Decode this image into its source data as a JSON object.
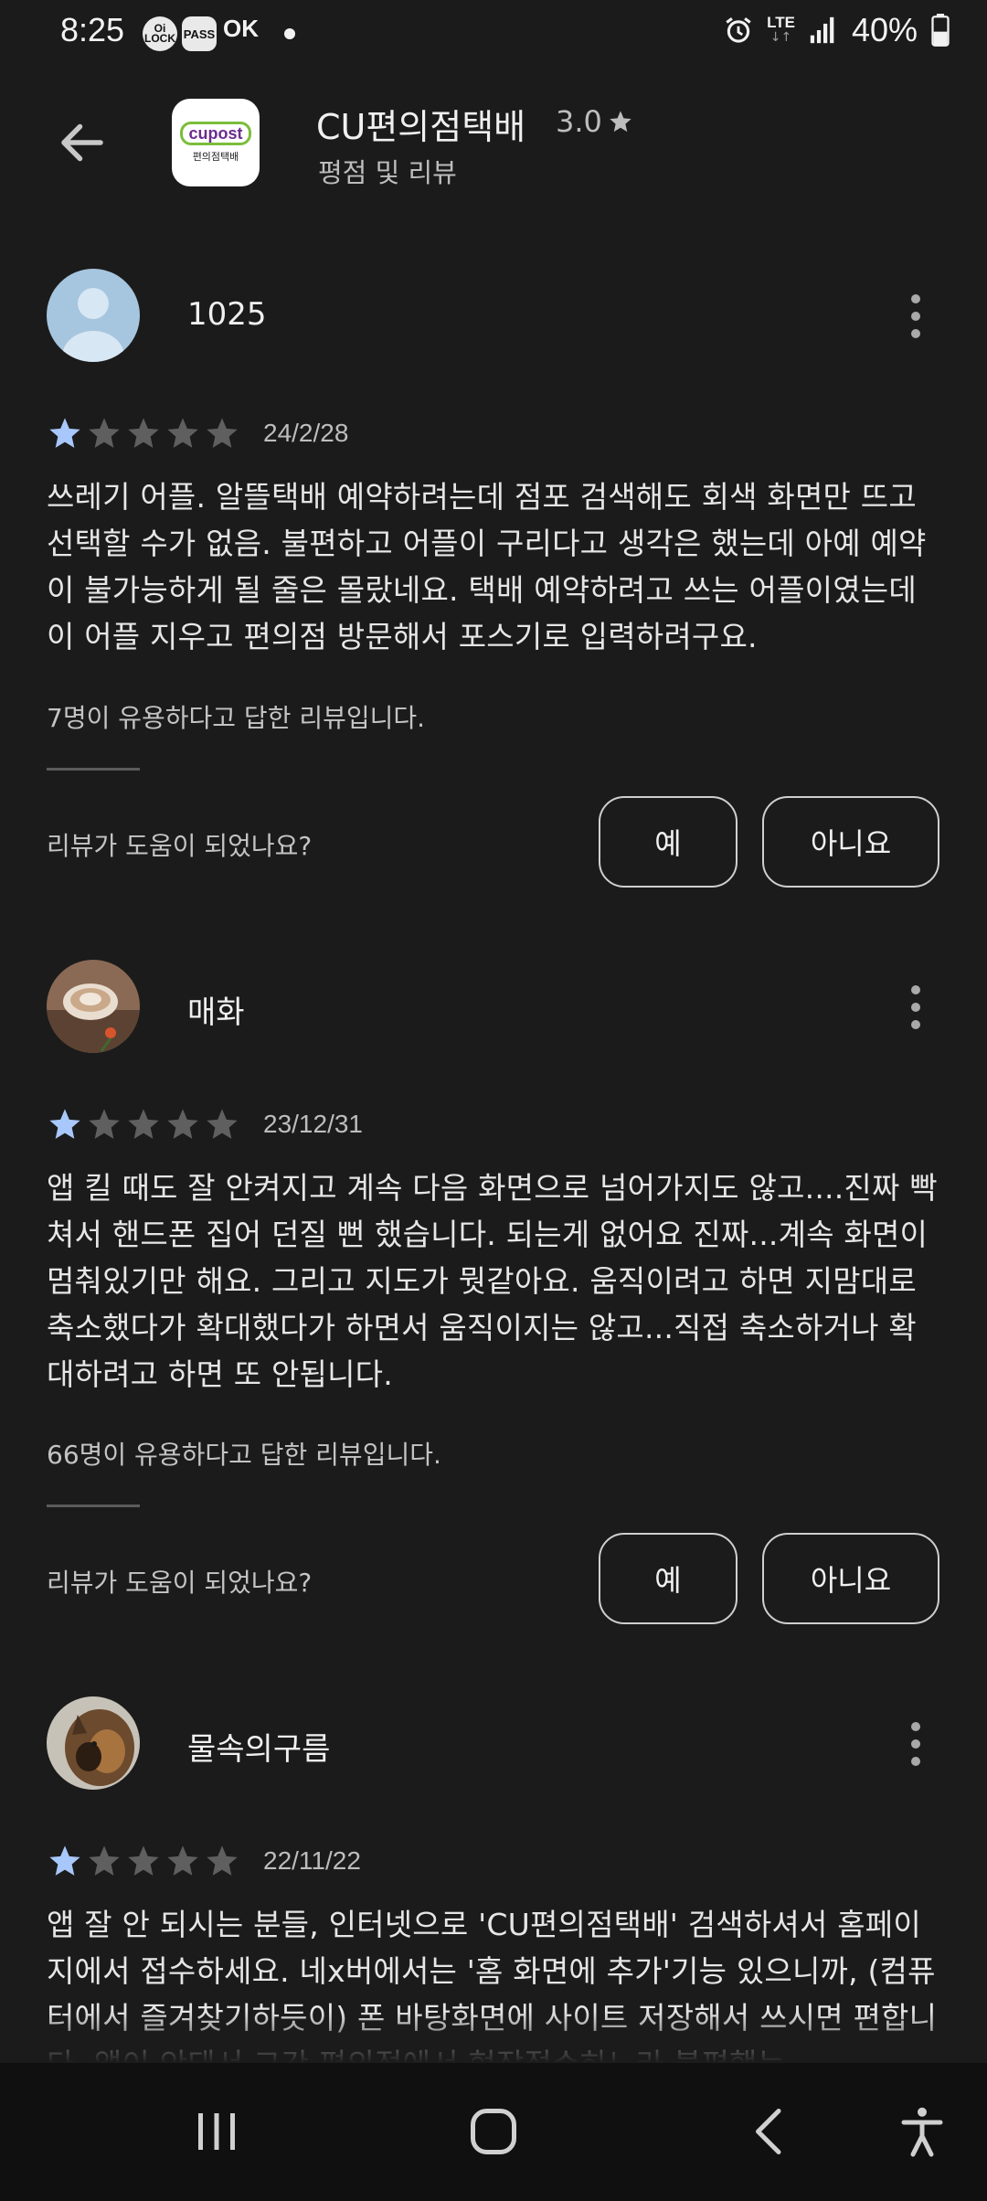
{
  "status_bar": {
    "time": "8:25",
    "badges": [
      "Oi LOCK",
      "PASS"
    ],
    "ok_label": "OK",
    "network": "LTE",
    "battery": "40%"
  },
  "header": {
    "app_name": "CU편의점택배",
    "rating": "3.0",
    "subtitle": "평점 및 리뷰",
    "logo_text": "cupost",
    "logo_subtext": "편의점택배"
  },
  "reviews": [
    {
      "name": "1025",
      "stars": 1,
      "date": "24/2/28",
      "body": "쓰레기 어플. 알뜰택배 예약하려는데 점포 검색해도 회색 화면만 뜨고 선택할 수가 없음. 불편하고 어플이 구리다고 생각은 했는데 아예 예약이 불가능하게 될 줄은 몰랐네요. 택배 예약하려고 쓰는 어플이였는데 이 어플 지우고 편의점 방문해서 포스기로 입력하려구요.",
      "helpful": "7명이 유용하다고 답한 리뷰입니다.",
      "question": "리뷰가 도움이 되었나요?",
      "yes": "예",
      "no": "아니요"
    },
    {
      "name": "매화",
      "stars": 1,
      "date": "23/12/31",
      "body": "앱 킬 때도 잘 안켜지고 계속 다음 화면으로 넘어가지도 않고....진짜 빡쳐서 핸드폰 집어 던질 뻔 했습니다. 되는게 없어요 진짜...계속 화면이 멈춰있기만 해요. 그리고 지도가 뭣같아요. 움직이려고 하면 지맘대로 축소했다가 확대했다가 하면서 움직이지는 않고...직접 축소하거나 확대하려고 하면 또 안됩니다.",
      "helpful": "66명이 유용하다고 답한 리뷰입니다.",
      "question": "리뷰가 도움이 되었나요?",
      "yes": "예",
      "no": "아니요"
    },
    {
      "name": "물속의구름",
      "stars": 1,
      "date": "22/11/22",
      "body": "앱 잘 안 되시는 분들, 인터넷으로 'CU편의점택배' 검색하셔서 홈페이지에서 접수하세요. 네x버에서는 '홈 화면에 추가'기능 있으니까, (컴퓨터에서 즐겨찾기하듯이) 폰 바탕화면에 사이트 저장해서 쓰시면 편합니다. 앱이 안돼서 그간 편의점에서 현장접수하느라 불편했는"
    }
  ],
  "nav": {
    "icons": [
      "recent-apps-icon",
      "home-icon",
      "back-icon",
      "accessibility-icon"
    ]
  },
  "colors": {
    "background": "#1b1b1b",
    "star_filled": "#a8c7fa",
    "star_empty": "#5f5f5f"
  }
}
